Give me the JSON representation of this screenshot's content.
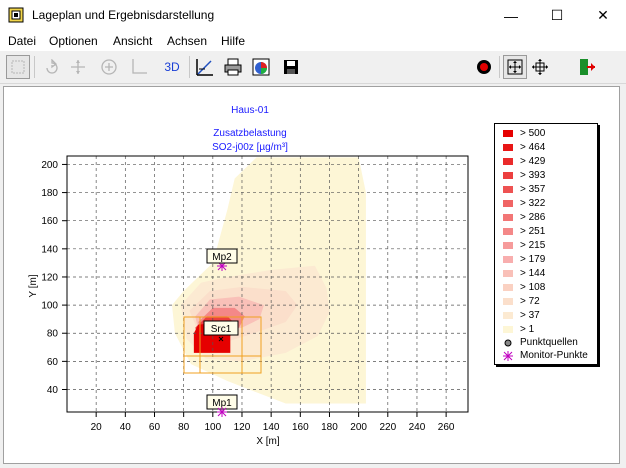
{
  "window": {
    "title": "Lageplan und Ergebnisdarstellung",
    "minimize_glyph": "—",
    "maximize_glyph": "☐",
    "close_glyph": "✕"
  },
  "menu": [
    "Datei",
    "Optionen",
    "Ansicht",
    "Achsen",
    "Hilfe"
  ],
  "toolbar": {
    "view3d_label": "3D",
    "icons": [
      "select-icon",
      "rotate-icon",
      "move-icon",
      "zoom-in-icon",
      "axes-icon",
      "3d-icon",
      "measure-icon",
      "print-icon",
      "color-palette-icon",
      "save-icon",
      "record-icon",
      "fit-view-icon",
      "expand-view-icon",
      "exit-icon"
    ]
  },
  "plot": {
    "title": "Haus-01",
    "subtitle": "Zusatzbelastung",
    "substance": "SO2-j00z [µg/m³]",
    "xlabel": "X [m]",
    "ylabel": "Y [m]",
    "xticks": [
      "20",
      "40",
      "60",
      "80",
      "100",
      "120",
      "140",
      "160",
      "180",
      "200",
      "220",
      "240",
      "260"
    ],
    "yticks": [
      "40",
      "60",
      "80",
      "100",
      "120",
      "140",
      "160",
      "180",
      "200"
    ],
    "labels": {
      "mp2": "Mp2",
      "src1": "Src1",
      "mp1": "Mp1"
    }
  },
  "legend": {
    "items": [
      {
        "label": "> 500",
        "color": "#e60000"
      },
      {
        "label": "> 464",
        "color": "#e81616"
      },
      {
        "label": "> 429",
        "color": "#ea2b2b"
      },
      {
        "label": "> 393",
        "color": "#ec3f3f"
      },
      {
        "label": "> 357",
        "color": "#ee5252"
      },
      {
        "label": "> 322",
        "color": "#f06464"
      },
      {
        "label": "> 286",
        "color": "#f27676"
      },
      {
        "label": "> 251",
        "color": "#f48888"
      },
      {
        "label": "> 215",
        "color": "#f69b9b"
      },
      {
        "label": "> 179",
        "color": "#f8aeae"
      },
      {
        "label": "> 144",
        "color": "#f9c0b8"
      },
      {
        "label": "> 108",
        "color": "#fad1c2"
      },
      {
        "label": "> 72",
        "color": "#fbdfcb"
      },
      {
        "label": "> 37",
        "color": "#fcead2"
      },
      {
        "label": "> 1",
        "color": "#fdf6d6"
      }
    ],
    "point_sources": "Punktquellen",
    "monitor_points": "Monitor-Punkte"
  }
}
